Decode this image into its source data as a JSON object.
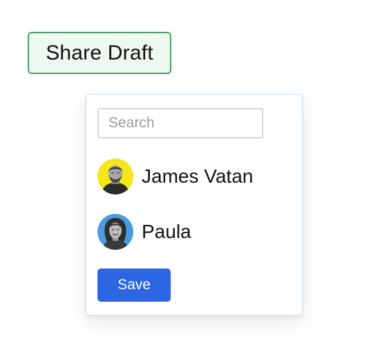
{
  "share_button": {
    "label": "Share Draft",
    "accent": "#4a9e63"
  },
  "share_panel": {
    "search": {
      "placeholder": "Search",
      "value": ""
    },
    "people": [
      {
        "name": "James Vatan",
        "avatar_color": "#f5e61a",
        "icon": "person-avatar-icon"
      },
      {
        "name": "Paula",
        "avatar_color": "#4a9ae0",
        "icon": "person-avatar-icon"
      }
    ],
    "save_label": "Save",
    "save_color": "#2c66e2"
  }
}
